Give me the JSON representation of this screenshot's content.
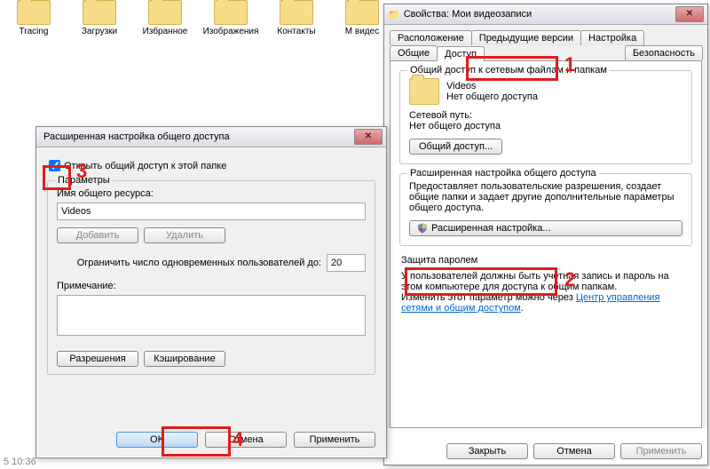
{
  "desktop": {
    "icons": [
      "Tracing",
      "Загрузки",
      "Избранное",
      "Изображения",
      "Контакты",
      "М видес"
    ],
    "time": "5 10:36"
  },
  "prop": {
    "title": "Свойства: Мои видеозаписи",
    "tabs": {
      "row1": [
        "Расположение",
        "Предыдущие версии",
        "Настройка"
      ],
      "row2": [
        "Общие",
        "Доступ",
        "Безопасность"
      ]
    },
    "sharing": {
      "group_label": "Общий доступ к сетевым файлам и папкам",
      "folder_name": "Videos",
      "status": "Нет общего доступа",
      "netpath_label": "Сетевой путь:",
      "netpath_value": "Нет общего доступа",
      "share_btn": "Общий доступ..."
    },
    "advanced": {
      "group_label": "Расширенная настройка общего доступа",
      "desc": "Предоставляет пользовательские разрешения, создает общие папки и задает другие дополнительные параметры общего доступа.",
      "btn": "Расширенная настройка..."
    },
    "password": {
      "group_label": "Защита паролем",
      "line1": "У пользователей должны быть учетная запись и пароль на этом компьютере для доступа к общим папкам.",
      "line2": "Изменить этот параметр можно через ",
      "link": "Центр управления сетями и общим доступом"
    },
    "buttons": {
      "close": "Закрыть",
      "cancel": "Отмена",
      "apply": "Применить"
    }
  },
  "adv": {
    "title": "Расширенная настройка общего доступа",
    "checkbox": "Открыть общий доступ к этой папке",
    "params": "Параметры",
    "share_name_label": "Имя общего ресурса:",
    "share_name_value": "Videos",
    "add": "Добавить",
    "remove": "Удалить",
    "limit_label": "Ограничить число одновременных пользователей до:",
    "limit_value": "20",
    "note_label": "Примечание:",
    "perm": "Разрешения",
    "cache": "Кэширование",
    "ok": "OK",
    "cancel": "Отмена",
    "apply": "Применить"
  },
  "markers": {
    "1": "1",
    "2": "2",
    "3": "3",
    "4": "4"
  }
}
